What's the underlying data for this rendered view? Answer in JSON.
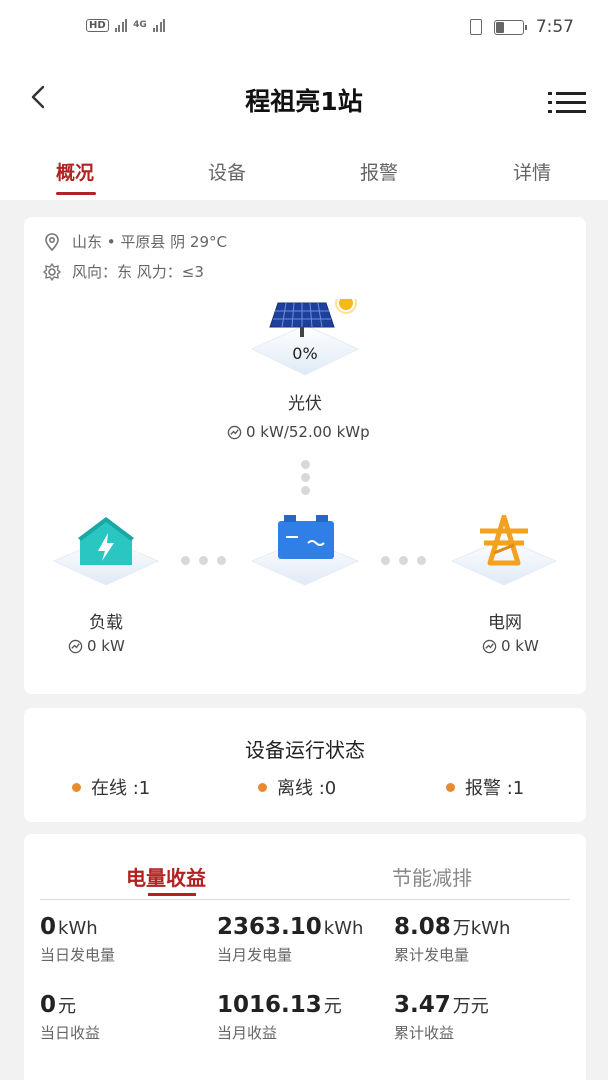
{
  "statusbar": {
    "network_left": "HD",
    "network_tag": "4G",
    "time": "7:57",
    "battery_level": 0.3
  },
  "header": {
    "title": "程祖亮1站"
  },
  "tabs": [
    {
      "label": "概况",
      "active": true
    },
    {
      "label": "设备",
      "active": false
    },
    {
      "label": "报警",
      "active": false
    },
    {
      "label": "详情",
      "active": false
    }
  ],
  "overview": {
    "location": "山东 • 平原县 阴 29°C",
    "wind": "风向：东 风力：≤3",
    "pv": {
      "percent": "0%",
      "label": "光伏",
      "power": "0 kW/52.00 kWp"
    },
    "load": {
      "label": "负载",
      "power": "0 kW"
    },
    "grid": {
      "label": "电网",
      "power": "0 kW"
    }
  },
  "device_status": {
    "title": "设备运行状态",
    "items": [
      {
        "label": "在线 :1"
      },
      {
        "label": "离线 :0"
      },
      {
        "label": "报警 :1"
      }
    ],
    "dot_color": "#e88a30"
  },
  "energy": {
    "tabs": [
      {
        "label": "电量收益",
        "active": true
      },
      {
        "label": "节能减排",
        "active": false
      }
    ],
    "metrics": [
      {
        "value": "0",
        "unit": "kWh",
        "label": "当日发电量"
      },
      {
        "value": "2363.10",
        "unit": "kWh",
        "label": "当月发电量"
      },
      {
        "value": "8.08",
        "unit": "万kWh",
        "label": "累计发电量"
      },
      {
        "value": "0",
        "unit": "元",
        "label": "当日收益"
      },
      {
        "value": "1016.13",
        "unit": "元",
        "label": "当月收益"
      },
      {
        "value": "3.47",
        "unit": "万元",
        "label": "累计收益"
      }
    ]
  },
  "colors": {
    "accent": "#b22222",
    "status_dot": "#e88a30"
  }
}
